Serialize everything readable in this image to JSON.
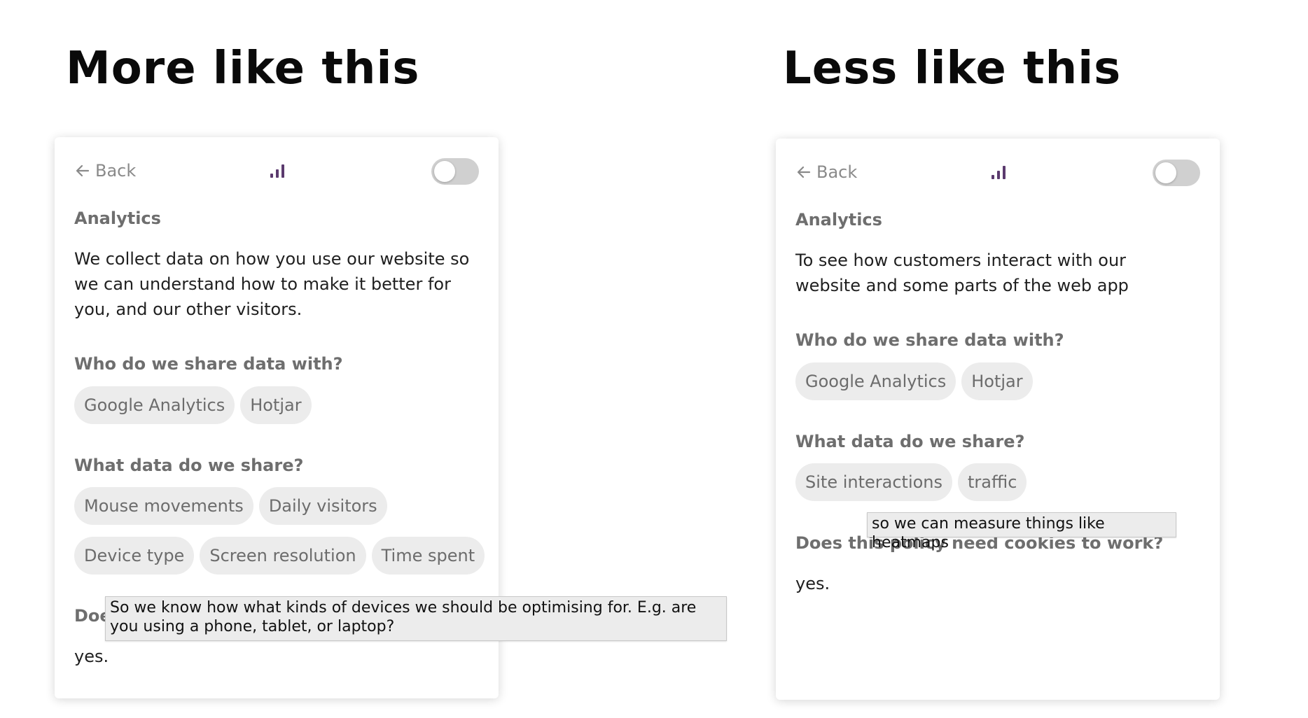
{
  "headings": {
    "left": "More like this",
    "right": "Less like this"
  },
  "cards": [
    {
      "back_label": "Back",
      "section_title": "Analytics",
      "description": "We collect data on how you use our website so we can understand how to make it better for you, and our other visitors.",
      "share_with_title": "Who do we share data with?",
      "share_with": [
        "Google Analytics",
        "Hotjar"
      ],
      "data_title": "What data do we share?",
      "data_items": [
        "Mouse movements",
        "Daily visitors",
        "Device type",
        "Screen resolution",
        "Time spent"
      ],
      "cookies_title_visible": "Doe",
      "cookies_answer": "yes.",
      "tooltip": "So we know how what kinds of devices we should be optimising for. E.g. are you using a phone, tablet, or laptop?"
    },
    {
      "back_label": "Back",
      "section_title": "Analytics",
      "description": "To see how customers interact with our website and some parts of the web app",
      "share_with_title": "Who do we share data with?",
      "share_with": [
        "Google Analytics",
        "Hotjar"
      ],
      "data_title": "What data do we share?",
      "data_items": [
        "Site interactions",
        "traffic"
      ],
      "cookies_title": "Does this policy need cookies to work?",
      "cookies_answer": "yes.",
      "tooltip": "so we can measure things like heatmaps"
    }
  ],
  "colors": {
    "accent": "#5b3a6e",
    "chip_bg": "#ececec",
    "toggle_off": "#d0d0d0"
  }
}
